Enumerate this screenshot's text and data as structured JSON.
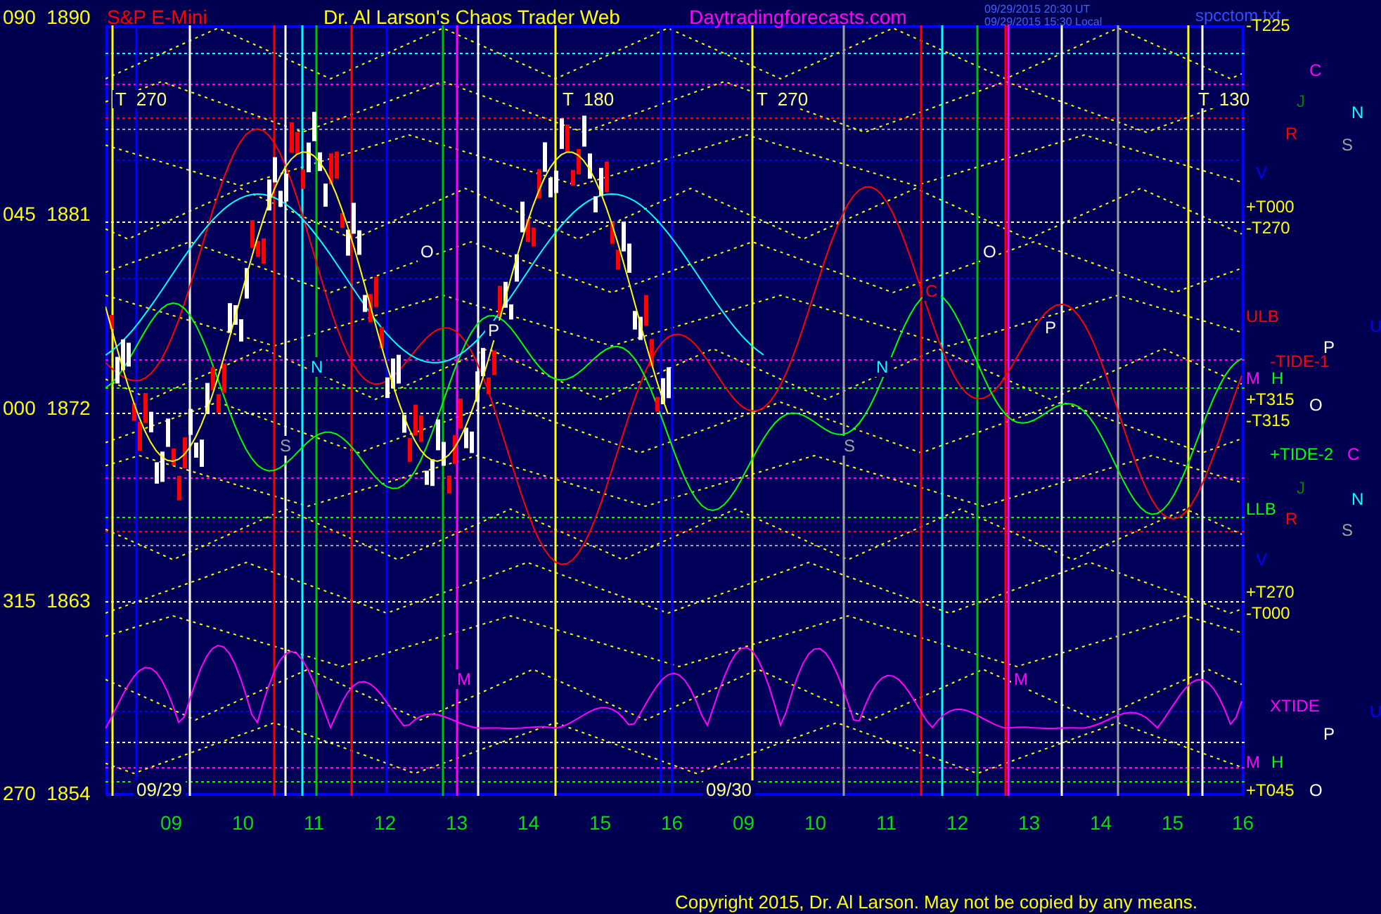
{
  "header": {
    "symbol": "S&P E-Mini",
    "title": "Dr. Al Larson's Chaos Trader Web",
    "site": "Daytradingforecasts.com",
    "timestamps": [
      "09/29/2015 20:30 UT",
      "09/29/2015 15:30 Local"
    ],
    "file": "spcctom.txt"
  },
  "price_axis": [
    {
      "angle": "090",
      "price": "1890"
    },
    {
      "angle": "045",
      "price": "1881"
    },
    {
      "angle": "000",
      "price": "1872"
    },
    {
      "angle": "315",
      "price": "1863"
    },
    {
      "angle": "270",
      "price": "1854"
    }
  ],
  "cycle_labels": [
    "T  270",
    "T  180",
    "T  270",
    "T  130"
  ],
  "date_labels": [
    "09/29",
    "09/30"
  ],
  "plot_letters": [
    {
      "text": "O",
      "color": "#ffffff"
    },
    {
      "text": "O",
      "color": "#ffffff"
    },
    {
      "text": "P",
      "color": "#ffffff"
    },
    {
      "text": "P",
      "color": "#ffffff"
    },
    {
      "text": "N",
      "color": "#00ffff"
    },
    {
      "text": "N",
      "color": "#00ffff"
    },
    {
      "text": "C",
      "color": "#ff0000"
    },
    {
      "text": "S",
      "color": "#a0a0a0"
    },
    {
      "text": "S",
      "color": "#a0a0a0"
    },
    {
      "text": "M",
      "color": "#ff00ff"
    },
    {
      "text": "M",
      "color": "#ff00ff"
    }
  ],
  "right_labels": [
    {
      "text": "-T225",
      "color": "#ffff00"
    },
    {
      "text": "C",
      "color": "#ff00ff"
    },
    {
      "text": "J",
      "color": "#008000"
    },
    {
      "text": "N",
      "color": "#00ffff"
    },
    {
      "text": "R",
      "color": "#ff0000"
    },
    {
      "text": "S",
      "color": "#a0a0a0"
    },
    {
      "text": "V",
      "color": "#0000ff"
    },
    {
      "text": "+T000",
      "color": "#ffff00"
    },
    {
      "text": "-T270",
      "color": "#ffff00"
    },
    {
      "text": "ULB",
      "color": "#ff0000"
    },
    {
      "text": "U",
      "color": "#0000ff"
    },
    {
      "text": "P",
      "color": "#ffffff"
    },
    {
      "text": "-TIDE-1",
      "color": "#ff0000"
    },
    {
      "text": "M",
      "color": "#ff00ff"
    },
    {
      "text": "H",
      "color": "#00ff00"
    },
    {
      "text": "+T315",
      "color": "#ffff00"
    },
    {
      "text": "-T315",
      "color": "#ffff00"
    },
    {
      "text": "O",
      "color": "#ffffff"
    },
    {
      "text": "+TIDE-2",
      "color": "#00ff00"
    },
    {
      "text": "C",
      "color": "#ff00ff"
    },
    {
      "text": "J",
      "color": "#008000"
    },
    {
      "text": "N",
      "color": "#00ffff"
    },
    {
      "text": "LLB",
      "color": "#00ff00"
    },
    {
      "text": "R",
      "color": "#ff0000"
    },
    {
      "text": "S",
      "color": "#a0a0a0"
    },
    {
      "text": "V",
      "color": "#0000ff"
    },
    {
      "text": "+T270",
      "color": "#ffff00"
    },
    {
      "text": "-T000",
      "color": "#ffff00"
    },
    {
      "text": "XTIDE",
      "color": "#ff00ff"
    },
    {
      "text": "U",
      "color": "#0000ff"
    },
    {
      "text": "P",
      "color": "#ffffff"
    },
    {
      "text": "M",
      "color": "#ff00ff"
    },
    {
      "text": "H",
      "color": "#00ff00"
    },
    {
      "text": "+T045",
      "color": "#ffff00"
    },
    {
      "text": "O",
      "color": "#ffffff"
    }
  ],
  "time_axis": [
    "09",
    "10",
    "11",
    "12",
    "13",
    "14",
    "15",
    "16",
    "09",
    "10",
    "11",
    "12",
    "13",
    "14",
    "15",
    "16"
  ],
  "copyright": "Copyright 2015, Dr. Al Larson. May not be copied by any means."
}
